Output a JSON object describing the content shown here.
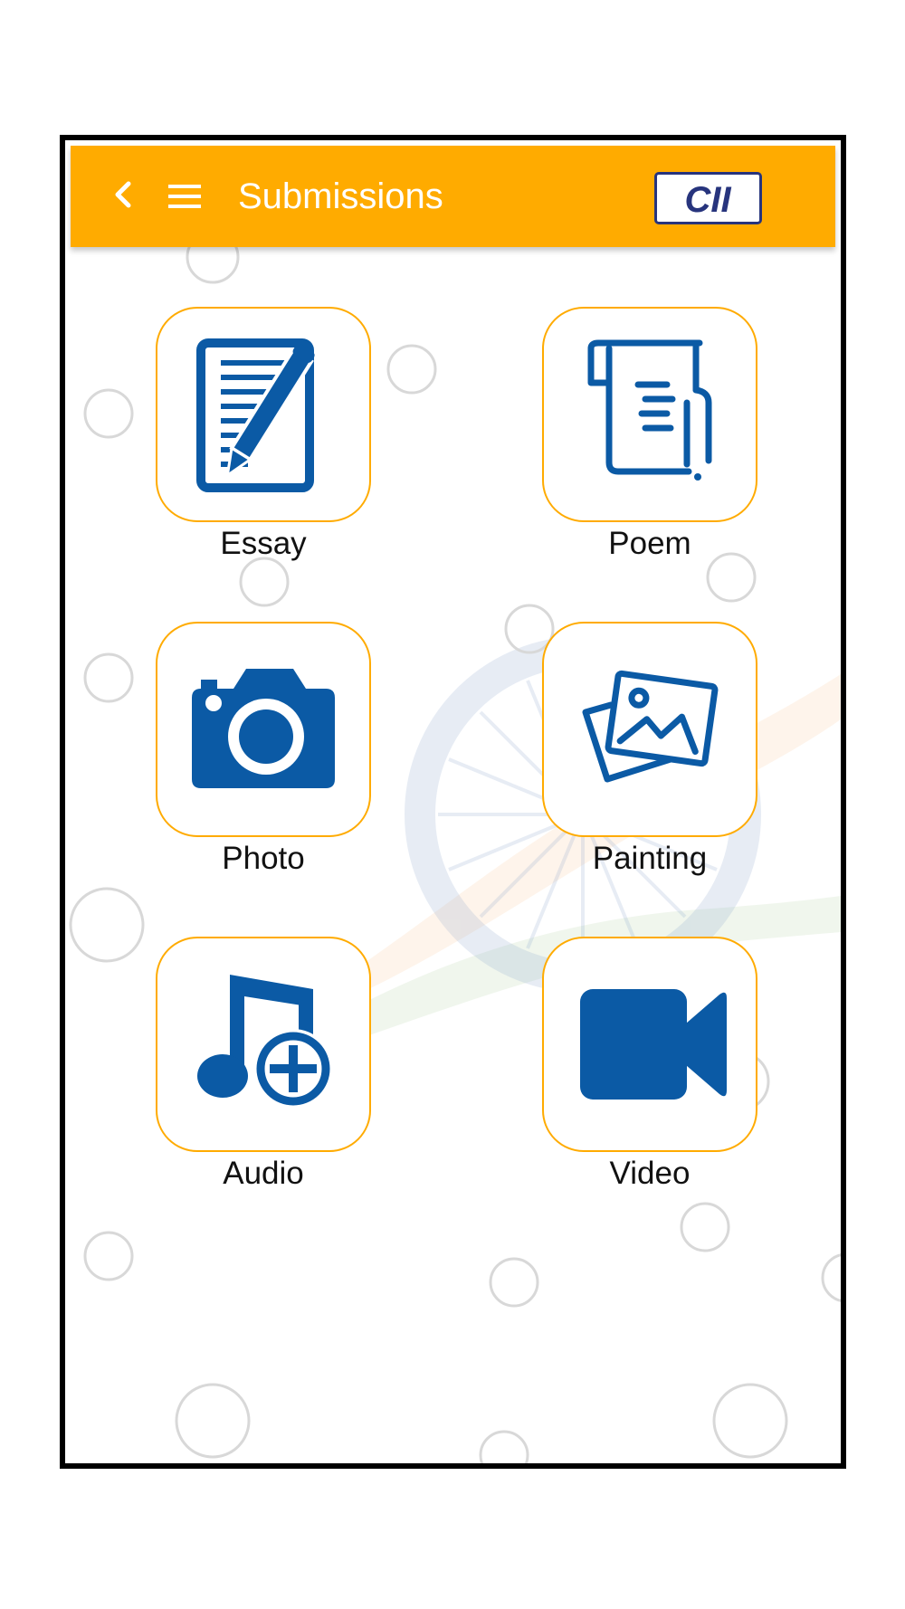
{
  "appbar": {
    "title": "Submissions",
    "back_icon": "chevron-left-icon",
    "menu_icon": "hamburger-menu-icon",
    "logo_text": "CII",
    "bg_color": "#FFAB00"
  },
  "tiles": [
    {
      "label": "Essay",
      "icon": "document-pen-icon"
    },
    {
      "label": "Poem",
      "icon": "scroll-icon"
    },
    {
      "label": "Photo",
      "icon": "camera-icon"
    },
    {
      "label": "Painting",
      "icon": "pictures-icon"
    },
    {
      "label": "Audio",
      "icon": "music-add-icon"
    },
    {
      "label": "Video",
      "icon": "video-camera-icon"
    }
  ],
  "colors": {
    "accent": "#FFAB00",
    "icon_blue": "#0b5aa5",
    "logo_navy": "#27347d"
  }
}
